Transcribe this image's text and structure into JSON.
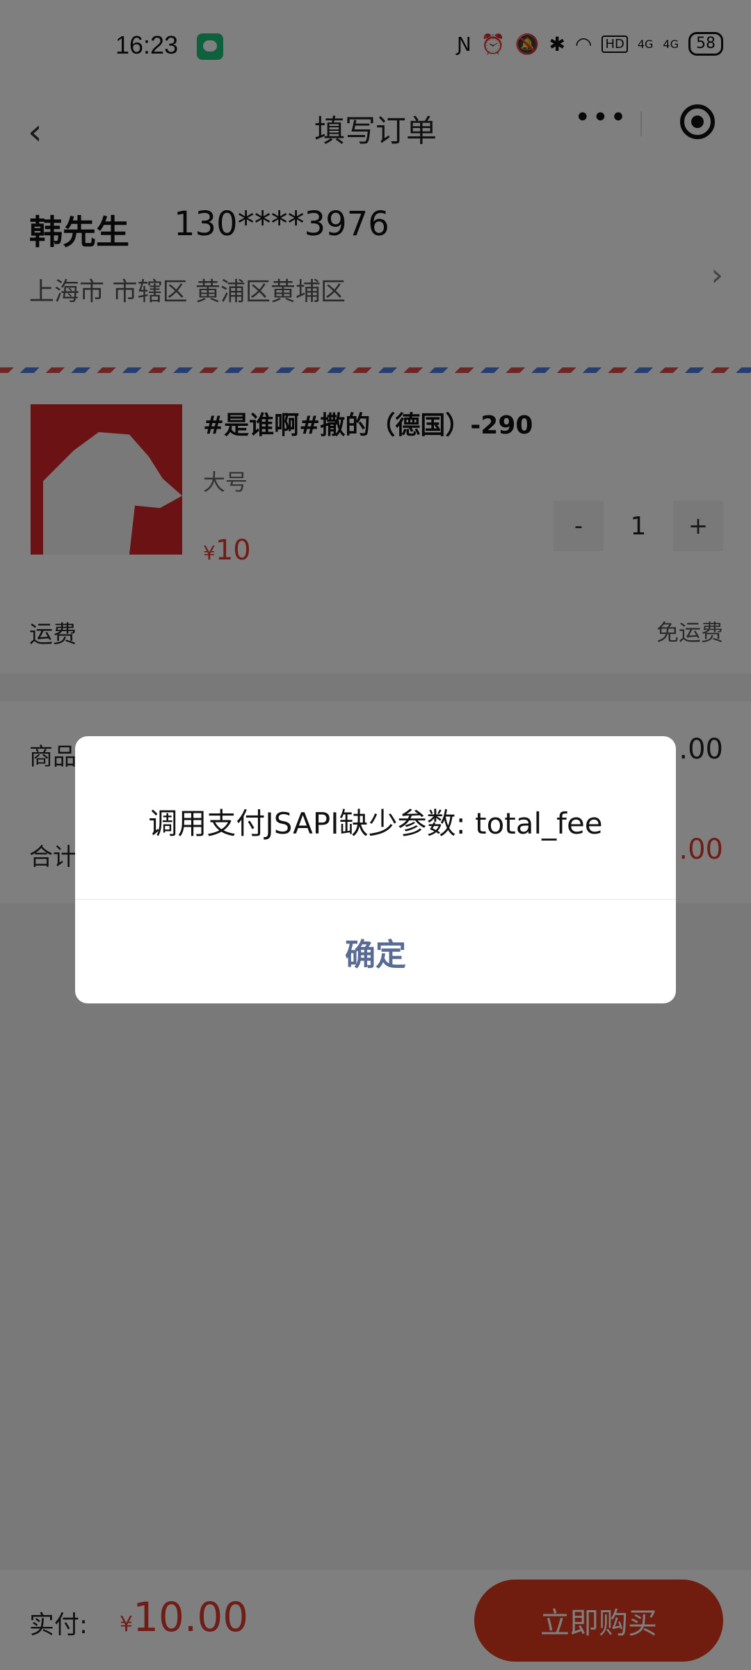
{
  "status": {
    "time": "16:23",
    "hd": "HD",
    "net1": "4G",
    "net2": "4G",
    "battery": "58"
  },
  "nav": {
    "title": "填写订单",
    "more": "•••"
  },
  "address": {
    "name": "韩先生",
    "phone": "130****3976",
    "detail": "上海市 市辖区 黄浦区黄埔区"
  },
  "product": {
    "title": "#是谁啊#撒的（德国）-290",
    "spec": "大号",
    "price_symbol": "¥",
    "price": "10",
    "quantity": "1",
    "minus": "-",
    "plus": "+"
  },
  "shipping": {
    "label": "运费",
    "value": "免运费"
  },
  "summary": {
    "goods_label": "商品",
    "goods_value": ".00",
    "total_label": "合计",
    "total_value": ".00"
  },
  "bottom": {
    "pay_label": "实付:",
    "pay_symbol": "¥",
    "pay_amount": "10.00",
    "buy_label": "立即购买"
  },
  "dialog": {
    "message": "调用支付JSAPI缺少参数: total_fee",
    "confirm": "确定"
  },
  "colors": {
    "accent": "#e03a2e",
    "dialog_button": "#576b95"
  }
}
